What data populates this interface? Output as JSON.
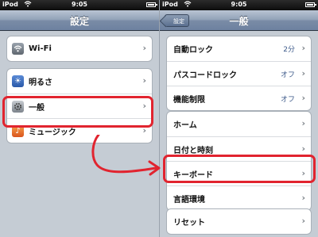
{
  "left": {
    "status": {
      "carrier": "iPod",
      "time": "9:05"
    },
    "nav_title": "設定",
    "group1": [
      {
        "label": "Wi-Fi"
      }
    ],
    "group2": [
      {
        "label": "明るさ"
      },
      {
        "label": "一般"
      },
      {
        "label": "ミュージック"
      }
    ]
  },
  "right": {
    "status": {
      "carrier": "iPod",
      "time": "9:05"
    },
    "back_label": "設定",
    "nav_title": "一般",
    "group1": [
      {
        "label": "自動ロック",
        "value": "2分"
      },
      {
        "label": "パスコードロック",
        "value": "オフ"
      },
      {
        "label": "機能制限",
        "value": "オフ"
      }
    ],
    "group2": [
      {
        "label": "ホーム"
      },
      {
        "label": "日付と時刻"
      },
      {
        "label": "キーボード"
      },
      {
        "label": "言語環境"
      }
    ],
    "group3": [
      {
        "label": "リセット"
      }
    ]
  },
  "annotation": {
    "highlight_color": "#e1242f"
  }
}
